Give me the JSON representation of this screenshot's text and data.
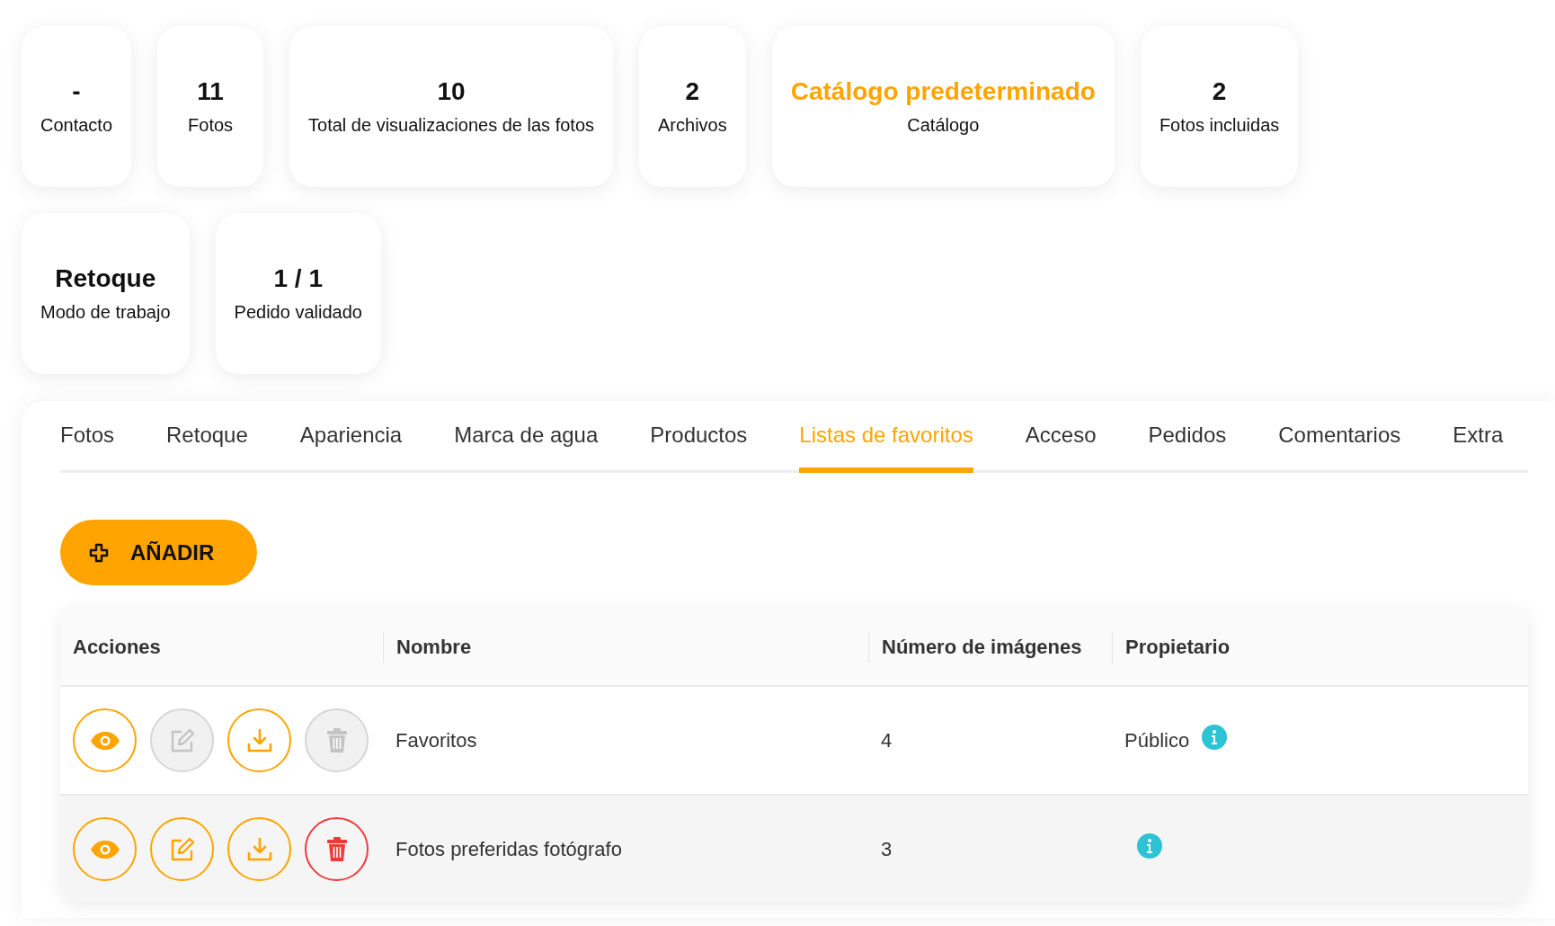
{
  "stats": [
    {
      "value": "-",
      "label": "Contacto",
      "highlight": false
    },
    {
      "value": "11",
      "label": "Fotos",
      "highlight": false
    },
    {
      "value": "10",
      "label": "Total de visualizaciones de las fotos",
      "highlight": false
    },
    {
      "value": "2",
      "label": "Archivos",
      "highlight": false
    },
    {
      "value": "Catálogo predeterminado",
      "label": "Catálogo",
      "highlight": true
    },
    {
      "value": "2",
      "label": "Fotos incluidas",
      "highlight": false
    },
    {
      "value": "Retoque",
      "label": "Modo de trabajo",
      "highlight": false
    },
    {
      "value": "1 / 1",
      "label": "Pedido validado",
      "highlight": false
    }
  ],
  "tabs": [
    {
      "label": "Fotos",
      "selected": false
    },
    {
      "label": "Retoque",
      "selected": false
    },
    {
      "label": "Apariencia",
      "selected": false
    },
    {
      "label": "Marca de agua",
      "selected": false
    },
    {
      "label": "Productos",
      "selected": false
    },
    {
      "label": "Listas de favoritos",
      "selected": true
    },
    {
      "label": "Acceso",
      "selected": false
    },
    {
      "label": "Pedidos",
      "selected": false
    },
    {
      "label": "Comentarios",
      "selected": false
    },
    {
      "label": "Extra",
      "selected": false
    }
  ],
  "add_button": {
    "label": "AÑADIR"
  },
  "table": {
    "columns": [
      "Acciones",
      "Nombre",
      "Número de imágenes",
      "Propietario"
    ],
    "rows": [
      {
        "actions": [
          {
            "kind": "view",
            "disabled": false
          },
          {
            "kind": "edit",
            "disabled": true
          },
          {
            "kind": "download",
            "disabled": false
          },
          {
            "kind": "delete",
            "disabled": true
          }
        ],
        "name": "Favoritos",
        "count": "4",
        "owner": "Público"
      },
      {
        "actions": [
          {
            "kind": "view",
            "disabled": false
          },
          {
            "kind": "edit",
            "disabled": false
          },
          {
            "kind": "download",
            "disabled": false
          },
          {
            "kind": "delete",
            "disabled": false
          }
        ],
        "name": "Fotos preferidas fotógrafo",
        "count": "3"
      }
    ]
  }
}
